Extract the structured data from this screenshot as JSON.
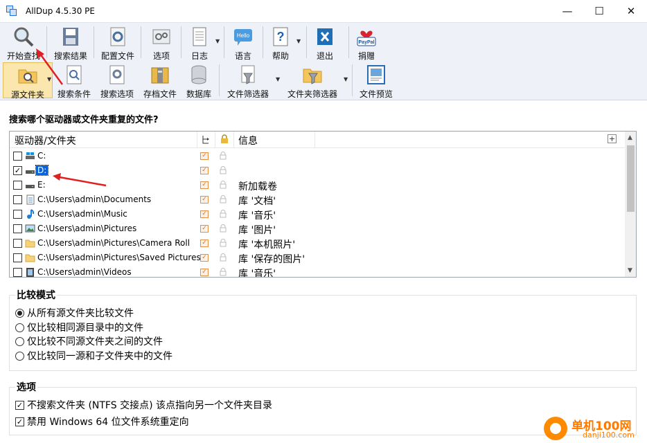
{
  "window": {
    "title": "AllDup 4.5.30 PE",
    "minimize": "—",
    "maximize": "☐",
    "close": "✕"
  },
  "toolbar_top": [
    {
      "label": "开始查找",
      "icon": "magnifier-icon"
    },
    {
      "label": "搜索结果",
      "icon": "disk-save-icon"
    },
    {
      "label": "配置文件",
      "icon": "profile-gear-icon"
    },
    {
      "label": "选项",
      "icon": "options-gear-icon"
    },
    {
      "label": "日志",
      "icon": "log-document-icon"
    },
    {
      "label": "语言",
      "icon": "hello-bubble-icon"
    },
    {
      "label": "帮助",
      "icon": "help-question-icon"
    },
    {
      "label": "退出",
      "icon": "exit-x-icon"
    },
    {
      "label": "捐赠",
      "icon": "paypal-heart-icon"
    }
  ],
  "toolbar_bottom": [
    {
      "label": "源文件夹",
      "icon": "folder-search-icon",
      "active": true
    },
    {
      "label": "搜索条件",
      "icon": "search-criteria-icon"
    },
    {
      "label": "搜索选项",
      "icon": "search-options-icon"
    },
    {
      "label": "存档文件",
      "icon": "archive-icon"
    },
    {
      "label": "数据库",
      "icon": "database-icon"
    },
    {
      "label": "文件筛选器",
      "icon": "file-filter-icon"
    },
    {
      "label": "文件夹筛选器",
      "icon": "folder-filter-icon"
    },
    {
      "label": "文件预览",
      "icon": "file-preview-icon"
    }
  ],
  "question": "搜索哪个驱动器或文件夹重复的文件?",
  "table": {
    "columns": {
      "path": "驱动器/文件夹",
      "info": "信息"
    },
    "rows": [
      {
        "path": "C:",
        "icon": "windows-drive-icon",
        "checked": false,
        "info": ""
      },
      {
        "path": "D:",
        "icon": "drive-icon",
        "checked": true,
        "info": "",
        "selected": true
      },
      {
        "path": "E:",
        "icon": "drive-icon",
        "checked": false,
        "info": "新加载卷"
      },
      {
        "path": "C:\\Users\\admin\\Documents",
        "icon": "documents-icon",
        "checked": false,
        "info": "库 '文档'"
      },
      {
        "path": "C:\\Users\\admin\\Music",
        "icon": "music-note-icon",
        "checked": false,
        "info": "库 '音乐'"
      },
      {
        "path": "C:\\Users\\admin\\Pictures",
        "icon": "pictures-icon",
        "checked": false,
        "info": "库 '图片'"
      },
      {
        "path": "C:\\Users\\admin\\Pictures\\Camera Roll",
        "icon": "folder-icon",
        "checked": false,
        "info": "库 '本机照片'"
      },
      {
        "path": "C:\\Users\\admin\\Pictures\\Saved Pictures",
        "icon": "folder-icon",
        "checked": false,
        "info": "库 '保存的图片'"
      },
      {
        "path": "C:\\Users\\admin\\Videos",
        "icon": "video-icon",
        "checked": false,
        "info": "库 '音乐'"
      }
    ]
  },
  "compare_mode": {
    "title": "比较模式",
    "options": [
      {
        "label": "从所有源文件夹比较文件",
        "selected": true
      },
      {
        "label": "仅比较相同源目录中的文件",
        "selected": false
      },
      {
        "label": "仅比较不同源文件夹之间的文件",
        "selected": false
      },
      {
        "label": "仅比较同一源和子文件夹中的文件",
        "selected": false
      }
    ]
  },
  "options": {
    "title": "选项",
    "items": [
      {
        "label": "不搜索文件夹 (NTFS 交接点) 该点指向另一个文件夹目录",
        "checked": true
      },
      {
        "label": "禁用 Windows 64 位文件系统重定向",
        "checked": true
      }
    ]
  },
  "watermark": {
    "name": "单机100网",
    "url": "danji100.com"
  },
  "colors": {
    "toolbar_bg": "#eef1f7",
    "active_tab": "#fbe6ad",
    "selection": "#0a64d8",
    "arrow": "#e02020"
  }
}
